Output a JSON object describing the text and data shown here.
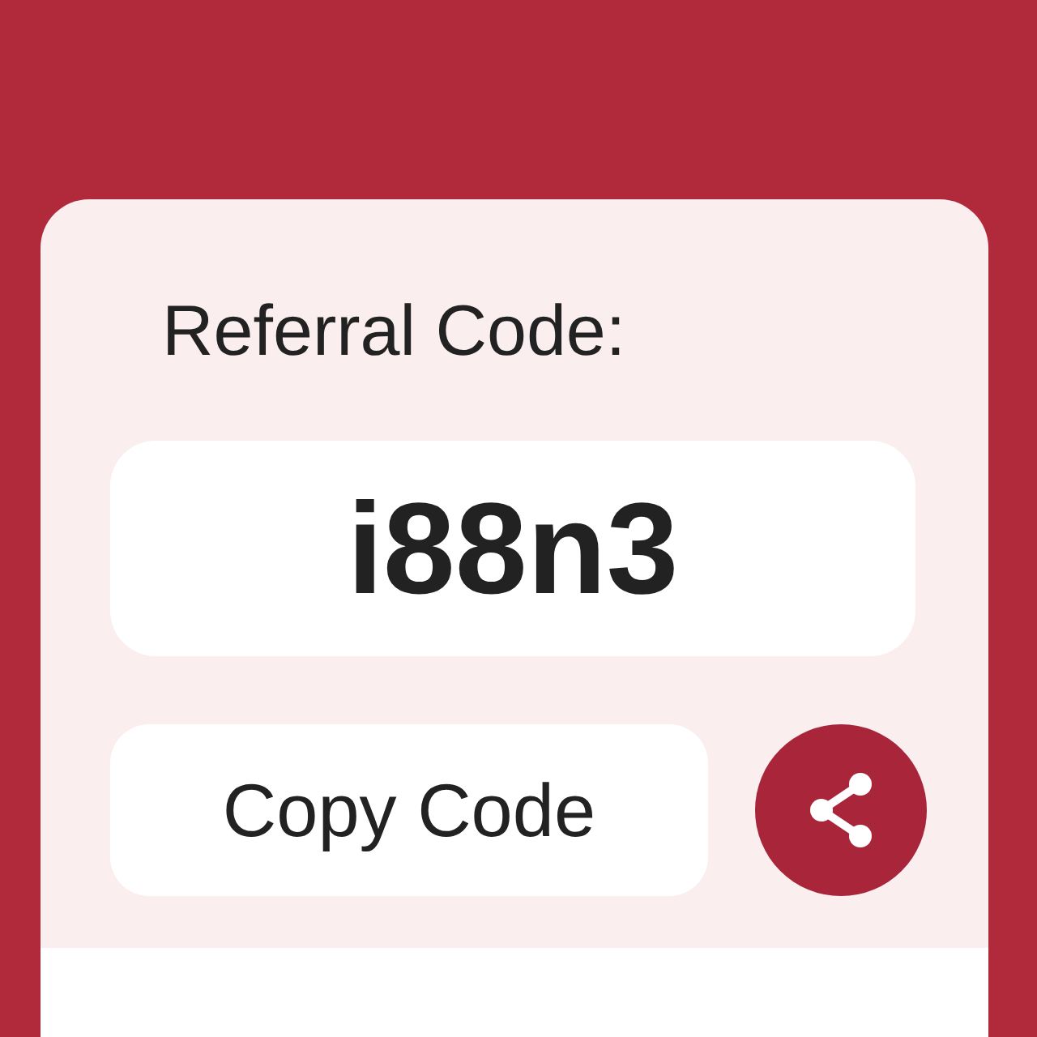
{
  "referral": {
    "title": "Referral Code:",
    "code": "i88n3",
    "copy_button": "Copy Code"
  }
}
